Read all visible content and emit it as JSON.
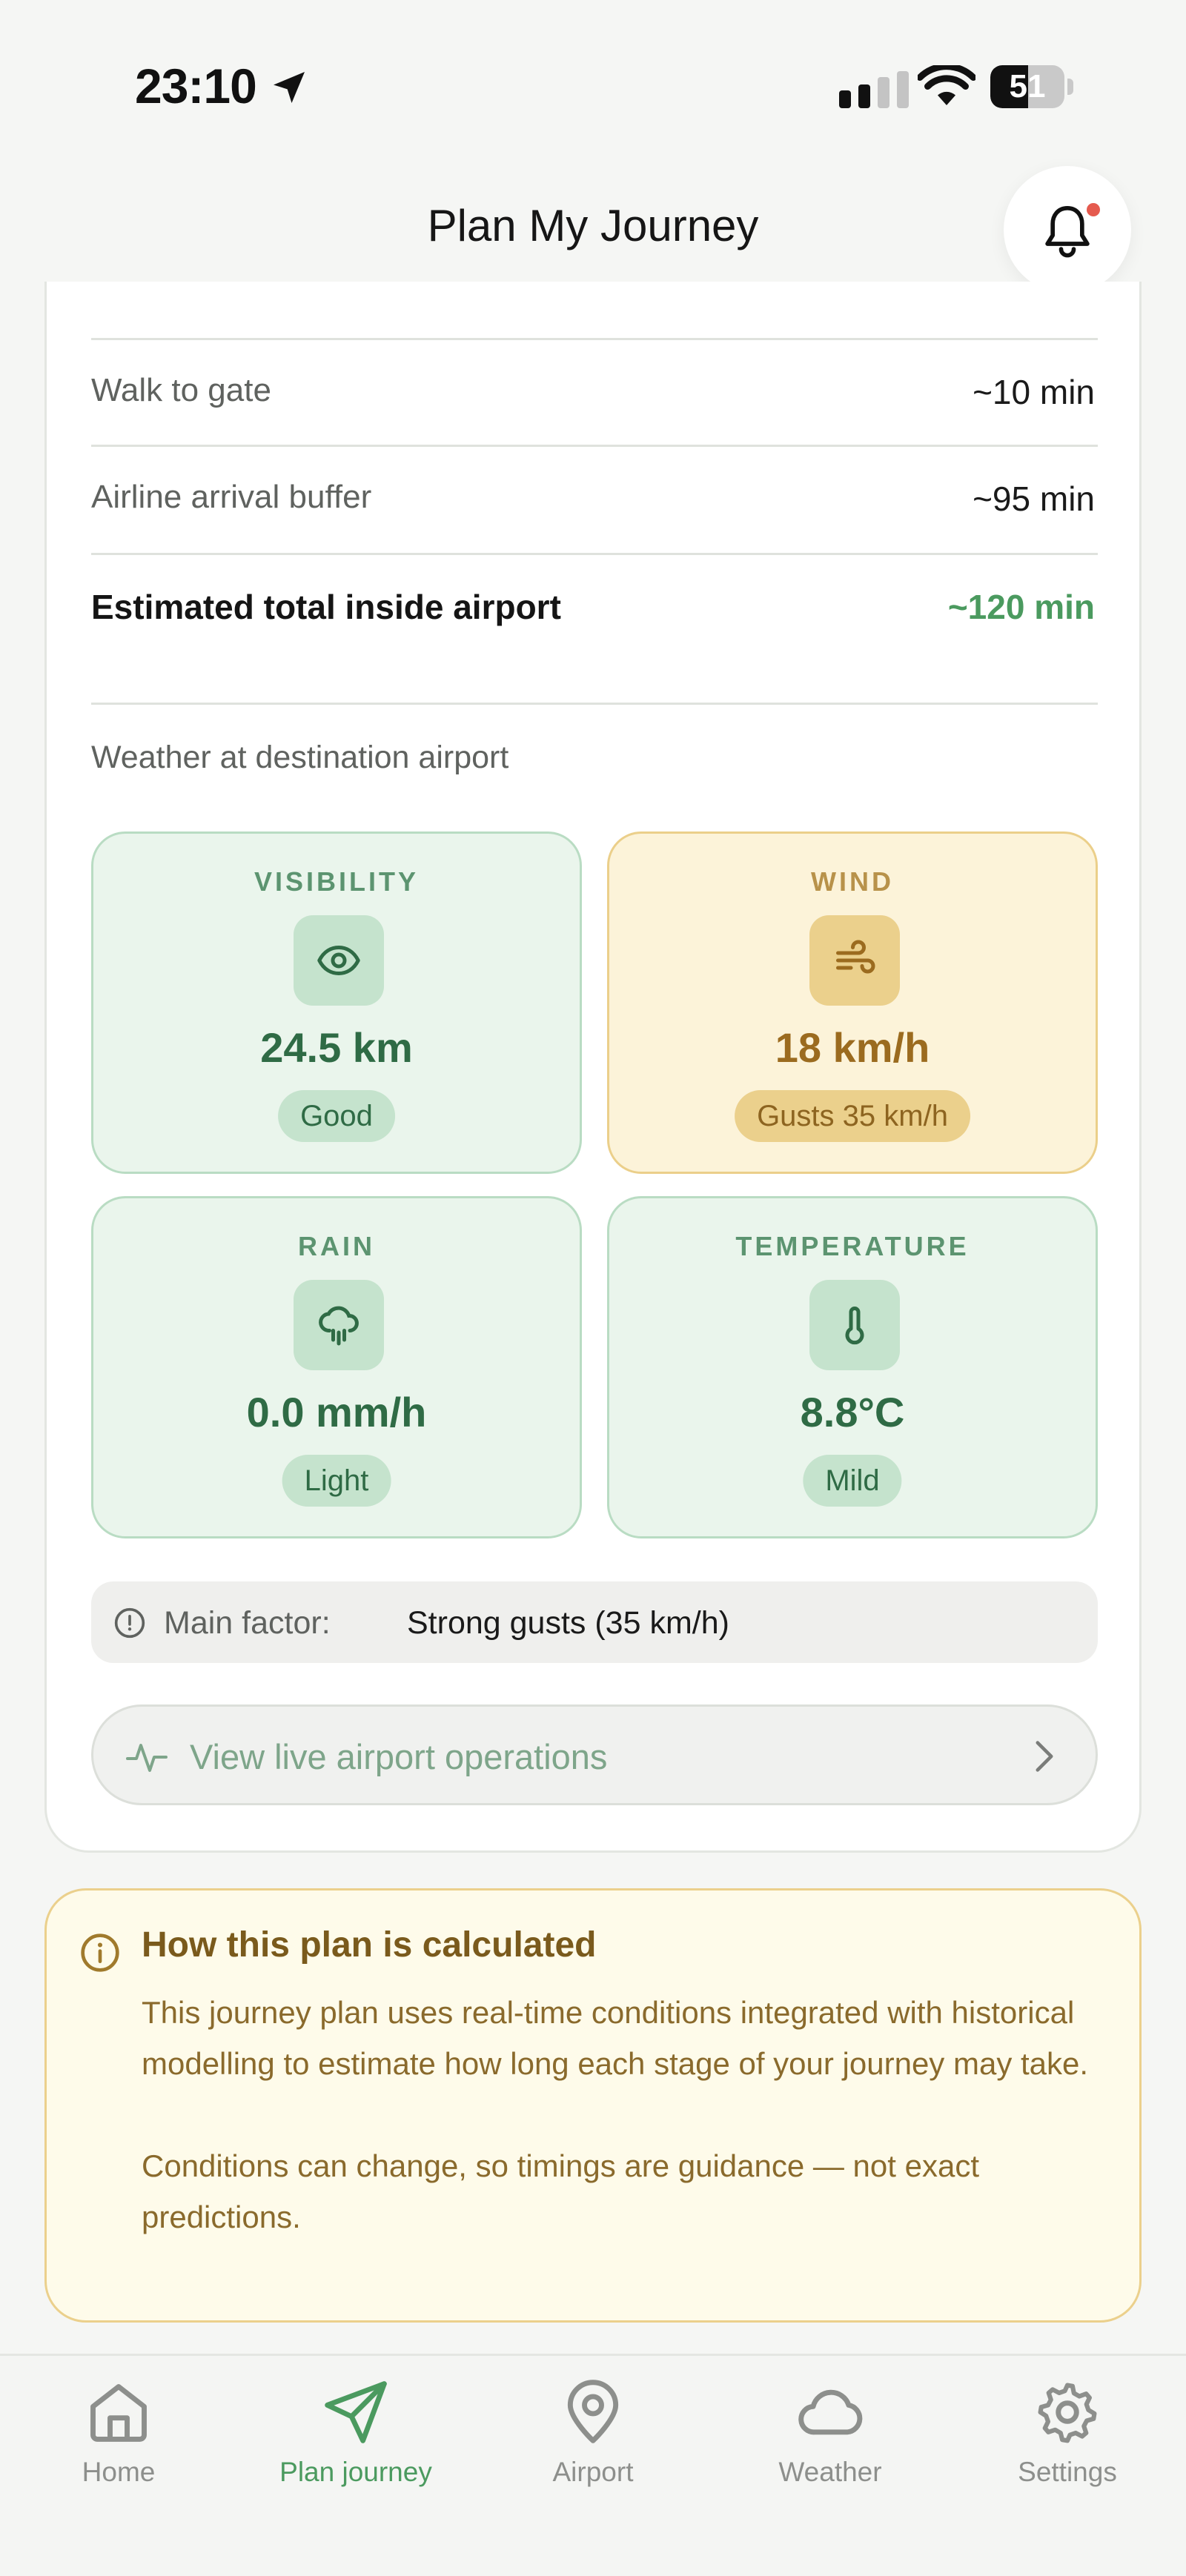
{
  "status_bar": {
    "time": "23:10",
    "battery": "51"
  },
  "header": {
    "title": "Plan My Journey"
  },
  "airport_times": [
    {
      "label": "Walk to gate",
      "value": "~10 min"
    },
    {
      "label": "Airline arrival buffer",
      "value": "~95 min"
    },
    {
      "label": "Estimated total inside airport",
      "value": "~120 min"
    }
  ],
  "weather": {
    "section_label": "Weather at destination airport",
    "tiles": [
      {
        "title": "VISIBILITY",
        "value": "24.5 km",
        "badge": "Good",
        "status": "green",
        "icon": "eye-icon"
      },
      {
        "title": "WIND",
        "value": "18 km/h",
        "badge": "Gusts 35 km/h",
        "status": "amber",
        "icon": "wind-icon"
      },
      {
        "title": "RAIN",
        "value": "0.0 mm/h",
        "badge": "Light",
        "status": "green",
        "icon": "rain-cloud-icon"
      },
      {
        "title": "TEMPERATURE",
        "value": "8.8°C",
        "badge": "Mild",
        "status": "green",
        "icon": "thermometer-icon"
      }
    ],
    "main_factor_label": "Main factor:",
    "main_factor_value": "Strong gusts (35 km/h)"
  },
  "ops_button": {
    "label": "View live airport operations"
  },
  "info": {
    "title": "How this plan is calculated",
    "paragraph1": "This journey plan uses real-time conditions integrated with historical modelling to estimate how long each stage of your journey may take.",
    "paragraph2": "Conditions can change, so timings are guidance — not exact predictions."
  },
  "nav": [
    {
      "label": "Home",
      "icon": "home-icon"
    },
    {
      "label": "Plan journey",
      "icon": "send-icon",
      "active": true
    },
    {
      "label": "Airport",
      "icon": "map-pin-icon"
    },
    {
      "label": "Weather",
      "icon": "cloud-icon"
    },
    {
      "label": "Settings",
      "icon": "gear-icon"
    }
  ],
  "colors": {
    "accent_green": "#4b9a5f",
    "amber": "#ebd08c",
    "notification_dot": "#e55a4e"
  }
}
